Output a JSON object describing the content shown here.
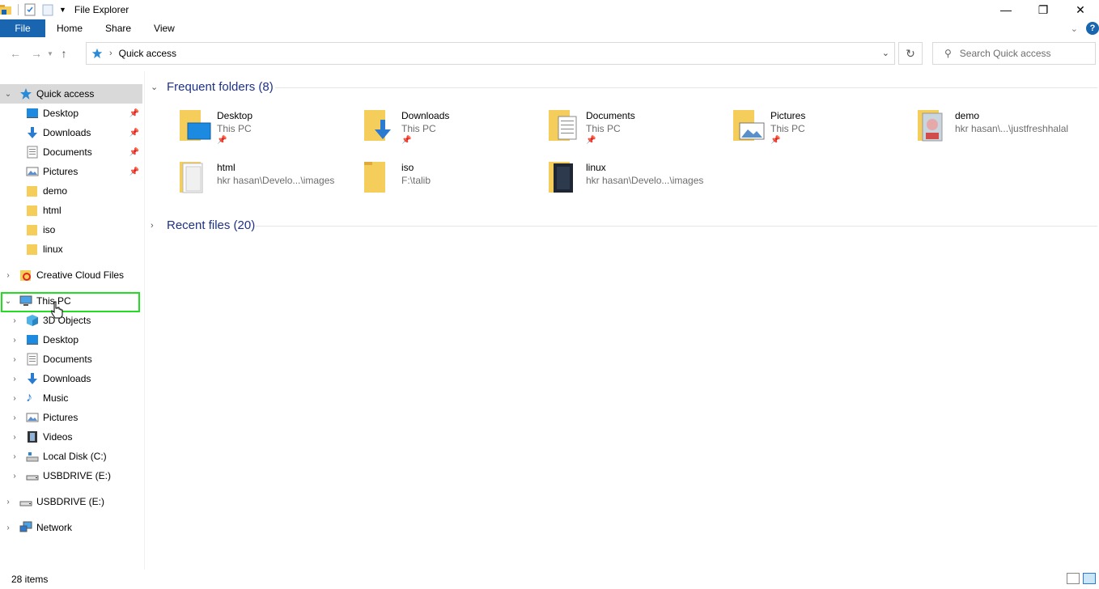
{
  "window": {
    "title": "File Explorer"
  },
  "ribbon": {
    "tabs": [
      {
        "label": "File"
      },
      {
        "label": "Home"
      },
      {
        "label": "Share"
      },
      {
        "label": "View"
      }
    ],
    "help_label": "?"
  },
  "address": {
    "path": "Quick access"
  },
  "search": {
    "placeholder": "Search Quick access"
  },
  "sidebar": {
    "quick_access": "Quick access",
    "quick_items": [
      {
        "label": "Desktop",
        "pinned": true
      },
      {
        "label": "Downloads",
        "pinned": true
      },
      {
        "label": "Documents",
        "pinned": true
      },
      {
        "label": "Pictures",
        "pinned": true
      },
      {
        "label": "demo",
        "pinned": false
      },
      {
        "label": "html",
        "pinned": false
      },
      {
        "label": "iso",
        "pinned": false
      },
      {
        "label": "linux",
        "pinned": false
      }
    ],
    "creative_cloud": "Creative Cloud Files",
    "this_pc": "This PC",
    "pc_items": [
      {
        "label": "3D Objects"
      },
      {
        "label": "Desktop"
      },
      {
        "label": "Documents"
      },
      {
        "label": "Downloads"
      },
      {
        "label": "Music"
      },
      {
        "label": "Pictures"
      },
      {
        "label": "Videos"
      },
      {
        "label": "Local Disk (C:)"
      },
      {
        "label": "USBDRIVE (E:)"
      }
    ],
    "usbdrive": "USBDRIVE (E:)",
    "network": "Network"
  },
  "main": {
    "frequent_header": "Frequent folders (8)",
    "recent_header": "Recent files (20)",
    "folders": [
      {
        "name": "Desktop",
        "location": "This PC",
        "pinned": true
      },
      {
        "name": "Downloads",
        "location": "This PC",
        "pinned": true
      },
      {
        "name": "Documents",
        "location": "This PC",
        "pinned": true
      },
      {
        "name": "Pictures",
        "location": "This PC",
        "pinned": true
      },
      {
        "name": "demo",
        "location": "hkr hasan\\...\\justfreshhalal",
        "pinned": false
      },
      {
        "name": "html",
        "location": "hkr hasan\\Develo...\\images",
        "pinned": false
      },
      {
        "name": "iso",
        "location": "F:\\talib",
        "pinned": false
      },
      {
        "name": "linux",
        "location": "hkr hasan\\Develo...\\images",
        "pinned": false
      }
    ]
  },
  "status": {
    "item_count": "28 items"
  },
  "colors": {
    "accent": "#1a65b0",
    "header_text": "#1e3287",
    "highlight": "#22dd22",
    "folder": "#f5cd5b"
  }
}
